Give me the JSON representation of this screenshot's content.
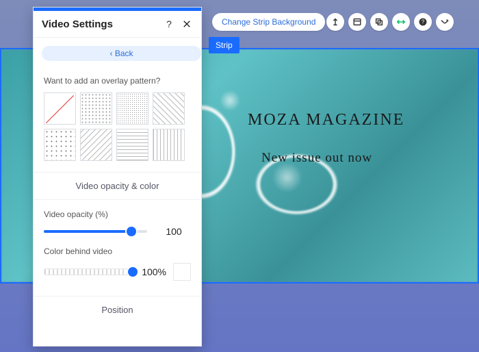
{
  "panel": {
    "title": "Video Settings",
    "back_label": "‹ Back",
    "overlay_question": "Want to add an overlay pattern?",
    "section_opacity_color": "Video opacity & color",
    "opacity_label": "Video opacity (%)",
    "opacity_value": "100",
    "color_label": "Color behind video",
    "color_value": "100%",
    "section_position": "Position"
  },
  "controls": {
    "change_strip_bg": "Change Strip Background",
    "strip_tag": "Strip"
  },
  "hero": {
    "title": "MOZA MAGAZINE",
    "subtitle": "New issue out now"
  }
}
